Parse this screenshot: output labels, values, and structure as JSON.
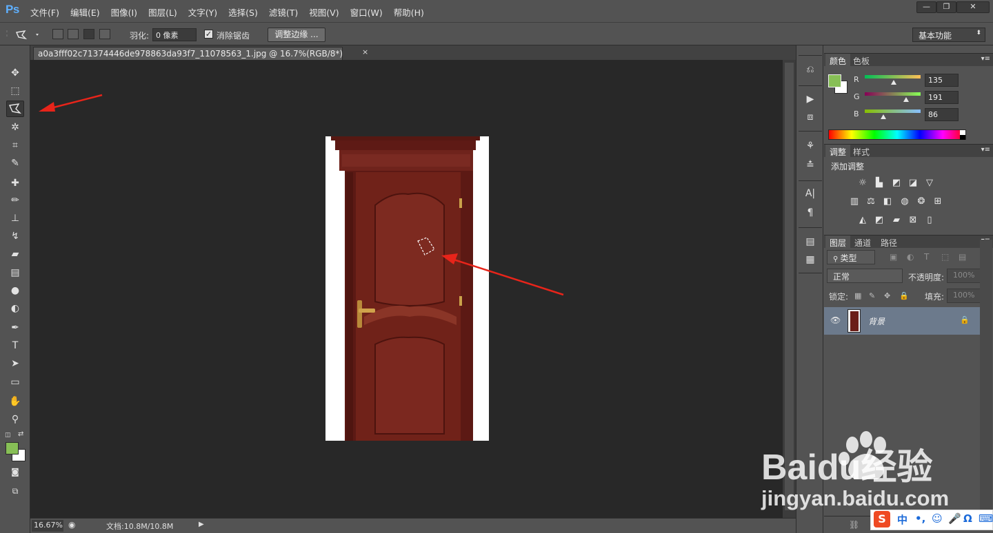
{
  "app": {
    "logo": "Ps",
    "menu": [
      "文件(F)",
      "编辑(E)",
      "图像(I)",
      "图层(L)",
      "文字(Y)",
      "选择(S)",
      "滤镜(T)",
      "视图(V)",
      "窗口(W)",
      "帮助(H)"
    ],
    "window_controls": {
      "minimize": "—",
      "restore": "❐",
      "close": "✕"
    }
  },
  "options_bar": {
    "feather_label": "羽化:",
    "feather_value": "0 像素",
    "antialias_label": "消除锯齿",
    "antialias_checked": true,
    "refine_edge_label": "调整边缘 ...",
    "workspace": "基本功能"
  },
  "document": {
    "tab_title": "a0a3fff02c71374446de978863da93f7_11078563_1.jpg @ 16.7%(RGB/8*)",
    "close_glyph": "×",
    "zoom": "16.67%",
    "doc_size": "文档:10.8M/10.8M"
  },
  "colors": {
    "foreground": "#87bf56",
    "background": "#ffffff",
    "canvas_bg": "#282828",
    "ui_bg": "#535353",
    "arrow": "#e8241a",
    "door": "#6b1f19"
  },
  "color_panel": {
    "tabs": [
      "颜色",
      "色板"
    ],
    "channels": [
      {
        "label": "R",
        "value": "135"
      },
      {
        "label": "G",
        "value": "191"
      },
      {
        "label": "B",
        "value": "86"
      }
    ]
  },
  "adjustments_panel": {
    "tabs": [
      "调整",
      "样式"
    ],
    "heading": "添加调整"
  },
  "layers_panel": {
    "tabs": [
      "图层",
      "通道",
      "路径"
    ],
    "filter_kind": "类型",
    "blend_mode": "正常",
    "opacity_label": "不透明度:",
    "opacity_value": "100%",
    "lock_label": "锁定:",
    "fill_label": "填充:",
    "fill_value": "100%",
    "layers": [
      {
        "name": "背景",
        "visible": true,
        "locked": true
      }
    ]
  },
  "watermark": {
    "brand": "Baidu经验",
    "url": "jingyan.baidu.com"
  },
  "ime": {
    "items": [
      "S",
      "中",
      "•,",
      "☺",
      "🎤",
      "Ω",
      "⌨"
    ]
  }
}
